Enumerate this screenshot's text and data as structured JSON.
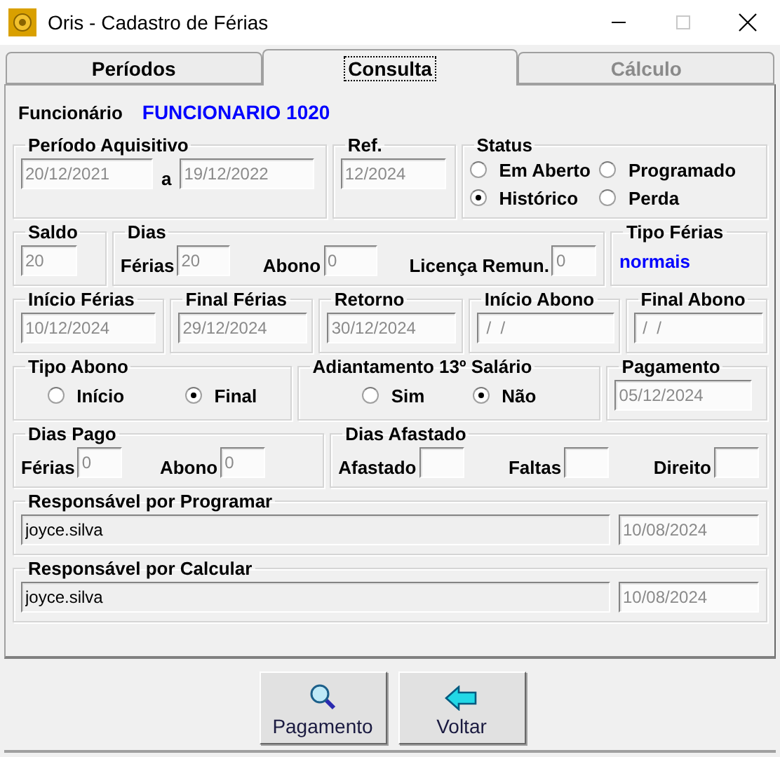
{
  "window": {
    "title": "Oris - Cadastro de Férias"
  },
  "tabs": [
    {
      "label": "Períodos",
      "selected": false,
      "disabled": false
    },
    {
      "label": "Consulta",
      "selected": true,
      "disabled": false
    },
    {
      "label": "Cálculo",
      "selected": false,
      "disabled": true
    }
  ],
  "employee": {
    "label": "Funcionário",
    "value": "FUNCIONARIO 1020"
  },
  "rows": [
    [
      {
        "title": "Período Aquisitivo",
        "items": [
          {
            "kind": "field",
            "value": "20/12/2021",
            "disabled": true
          },
          {
            "kind": "label",
            "text": "a"
          },
          {
            "kind": "field",
            "value": "19/12/2022",
            "disabled": true
          }
        ]
      },
      {
        "title": "Ref.",
        "items": [
          {
            "kind": "field",
            "value": "12/2024",
            "disabled": true
          }
        ]
      },
      {
        "title": "Status",
        "items": [
          {
            "kind": "radio",
            "label": "Em Aberto",
            "selected": false
          },
          {
            "kind": "radio",
            "label": "Programado",
            "selected": false
          },
          {
            "kind": "radio",
            "label": "Histórico",
            "selected": true
          },
          {
            "kind": "radio",
            "label": "Perda",
            "selected": false
          }
        ]
      }
    ],
    [
      {
        "title": "Saldo",
        "items": [
          {
            "kind": "field",
            "value": "20",
            "disabled": true
          }
        ]
      },
      {
        "title": "Dias",
        "items": [
          {
            "kind": "field",
            "label": "Férias",
            "value": "20",
            "disabled": true
          },
          {
            "kind": "field",
            "label": "Abono",
            "value": "0",
            "disabled": true
          },
          {
            "kind": "field",
            "label": "Licença Remun.",
            "value": "0",
            "disabled": true
          }
        ]
      },
      {
        "title": "Tipo Férias",
        "items": [
          {
            "kind": "value",
            "text": "normais"
          }
        ]
      }
    ],
    [
      {
        "title": "Início Férias",
        "items": [
          {
            "kind": "field",
            "value": "10/12/2024",
            "disabled": true
          }
        ]
      },
      {
        "title": "Final Férias",
        "items": [
          {
            "kind": "field",
            "value": "29/12/2024",
            "disabled": true
          }
        ]
      },
      {
        "title": "Retorno",
        "items": [
          {
            "kind": "field",
            "value": "30/12/2024",
            "disabled": true
          }
        ]
      },
      {
        "title": "Início Abono",
        "items": [
          {
            "kind": "field",
            "value": " /  /",
            "disabled": true
          }
        ]
      },
      {
        "title": "Final Abono",
        "items": [
          {
            "kind": "field",
            "value": " /  /",
            "disabled": true
          }
        ]
      }
    ],
    [
      {
        "title": "Tipo Abono",
        "items": [
          {
            "kind": "radio",
            "label": "Início",
            "selected": false
          },
          {
            "kind": "radio",
            "label": "Final",
            "selected": true
          }
        ]
      },
      {
        "title": "Adiantamento 13º Salário",
        "items": [
          {
            "kind": "radio",
            "label": "Sim",
            "selected": false
          },
          {
            "kind": "radio",
            "label": "Não",
            "selected": true
          }
        ]
      },
      {
        "title": "Pagamento",
        "items": [
          {
            "kind": "field",
            "value": "05/12/2024",
            "disabled": true
          }
        ]
      }
    ],
    [
      {
        "title": "Dias Pago",
        "items": [
          {
            "kind": "field",
            "label": "Férias",
            "value": "0",
            "disabled": true
          },
          {
            "kind": "field",
            "label": "Abono",
            "value": "0",
            "disabled": true
          }
        ]
      },
      {
        "title": "Dias Afastado",
        "items": [
          {
            "kind": "field",
            "label": "Afastado",
            "disabled": true
          },
          {
            "kind": "field",
            "label": "Faltas",
            "disabled": true
          },
          {
            "kind": "field",
            "label": "Direito",
            "disabled": true
          }
        ]
      }
    ],
    [
      {
        "title": "Responsável por Programar",
        "items": [
          {
            "kind": "field",
            "value": "joyce.silva",
            "disabled": false
          },
          {
            "kind": "field",
            "value": "10/08/2024",
            "disabled": true
          }
        ]
      }
    ],
    [
      {
        "title": "Responsável por Calcular",
        "items": [
          {
            "kind": "field",
            "value": "joyce.silva",
            "disabled": false
          },
          {
            "kind": "field",
            "value": "10/08/2024",
            "disabled": true
          }
        ]
      }
    ]
  ],
  "buttons": [
    "Pagamento",
    "Voltar"
  ]
}
